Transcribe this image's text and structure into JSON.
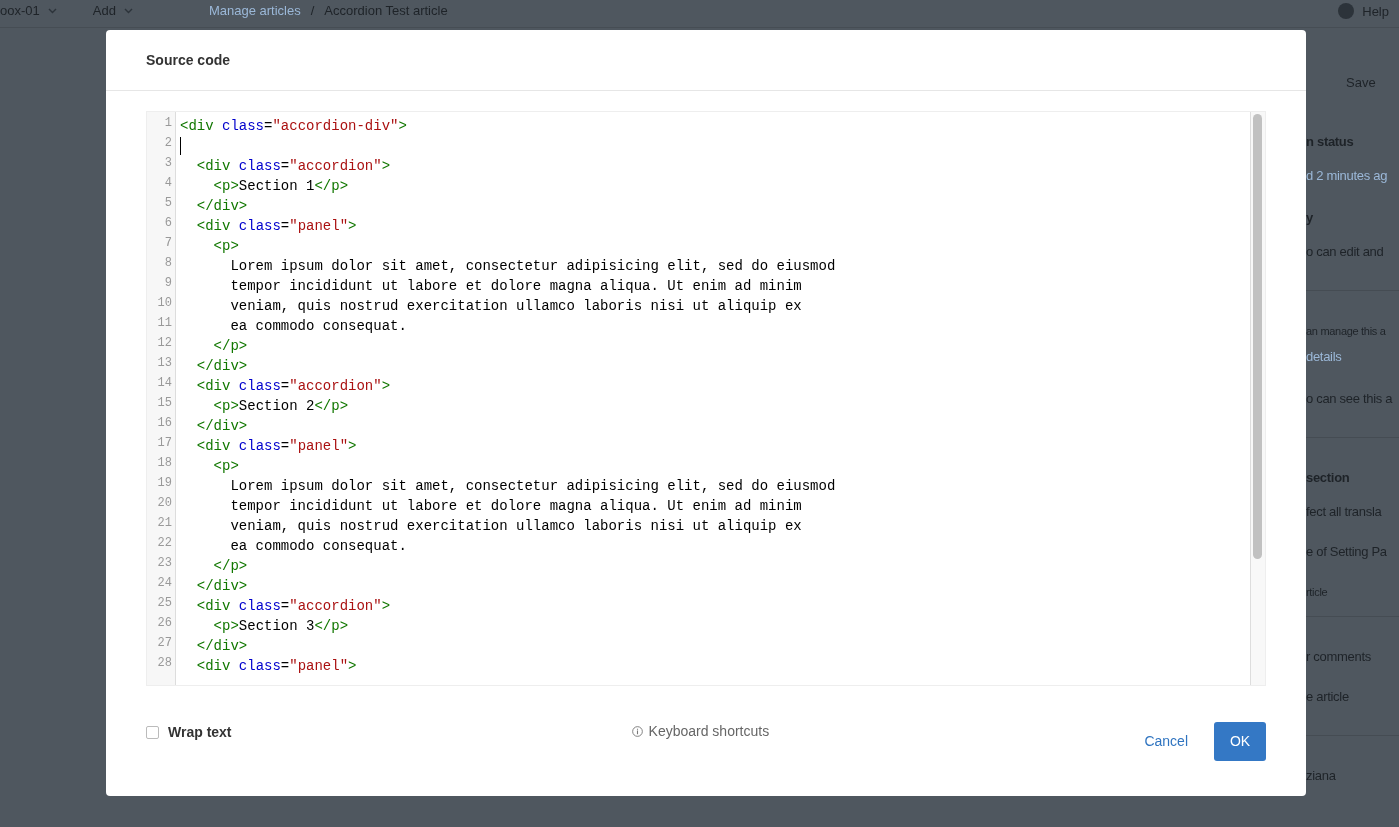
{
  "background_page": {
    "top_bar": {
      "items": [
        "oox-01",
        "Add"
      ],
      "breadcrumb": [
        "Manage articles",
        "/",
        "Accordion Test article"
      ],
      "help": "Help"
    },
    "side_panel": {
      "save_button": "Save",
      "fragments": [
        {
          "kind": "heading",
          "text": "n status"
        },
        {
          "kind": "link",
          "text": "d 2 minutes ag"
        },
        {
          "kind": "heading",
          "text": "y"
        },
        {
          "kind": "text",
          "text": "o can edit and"
        },
        {
          "kind": "rule"
        },
        {
          "kind": "small",
          "text": "an manage this a"
        },
        {
          "kind": "link",
          "text": "details"
        },
        {
          "kind": "text",
          "text": "o can see this a"
        },
        {
          "kind": "rule"
        },
        {
          "kind": "heading",
          "text": "section"
        },
        {
          "kind": "text",
          "text": "fect all transla"
        },
        {
          "kind": "text",
          "text": "e of Setting Pa"
        },
        {
          "kind": "small",
          "text": "rticle"
        },
        {
          "kind": "rule"
        },
        {
          "kind": "text",
          "text": "r comments"
        },
        {
          "kind": "text",
          "text": "e article"
        },
        {
          "kind": "rule"
        },
        {
          "kind": "text",
          "text": "ziana"
        }
      ]
    }
  },
  "dialog": {
    "title": "Source code",
    "editor": {
      "lines": [
        {
          "number": "1",
          "code": "<div class=\"accordion-div\">",
          "cursor": false
        },
        {
          "number": "2",
          "cursor": true
        },
        {
          "number": "3",
          "code": "  <div class=\"accordion\">",
          "cursor": false
        },
        {
          "number": "4",
          "code": "    <p>Section 1</p>",
          "cursor": false
        },
        {
          "number": "5",
          "code": "  </div>",
          "cursor": false
        },
        {
          "number": "6",
          "code": "  <div class=\"panel\">",
          "cursor": false
        },
        {
          "number": "7",
          "code": "    <p>",
          "cursor": false
        },
        {
          "number": "8",
          "code": "      Lorem ipsum dolor sit amet, consectetur adipisicing elit, sed do eiusmod",
          "cursor": false
        },
        {
          "number": "9",
          "code": "      tempor incididunt ut labore et dolore magna aliqua. Ut enim ad minim",
          "cursor": false
        },
        {
          "number": "10",
          "code": "      veniam, quis nostrud exercitation ullamco laboris nisi ut aliquip ex",
          "cursor": false
        },
        {
          "number": "11",
          "code": "      ea commodo consequat.",
          "cursor": false
        },
        {
          "number": "12",
          "code": "    </p>",
          "cursor": false
        },
        {
          "number": "13",
          "code": "  </div>",
          "cursor": false
        },
        {
          "number": "14",
          "code": "  <div class=\"accordion\">",
          "cursor": false
        },
        {
          "number": "15",
          "code": "    <p>Section 2</p>",
          "cursor": false
        },
        {
          "number": "16",
          "code": "  </div>",
          "cursor": false
        },
        {
          "number": "17",
          "code": "  <div class=\"panel\">",
          "cursor": false
        },
        {
          "number": "18",
          "code": "    <p>",
          "cursor": false
        },
        {
          "number": "19",
          "code": "      Lorem ipsum dolor sit amet, consectetur adipisicing elit, sed do eiusmod",
          "cursor": false
        },
        {
          "number": "20",
          "code": "      tempor incididunt ut labore et dolore magna aliqua. Ut enim ad minim",
          "cursor": false
        },
        {
          "number": "21",
          "code": "      veniam, quis nostrud exercitation ullamco laboris nisi ut aliquip ex",
          "cursor": false
        },
        {
          "number": "22",
          "code": "      ea commodo consequat.",
          "cursor": false
        },
        {
          "number": "23",
          "code": "    </p>",
          "cursor": false
        },
        {
          "number": "24",
          "code": "  </div>",
          "cursor": false
        },
        {
          "number": "25",
          "code": "  <div class=\"accordion\">",
          "cursor": false
        },
        {
          "number": "26",
          "code": "    <p>Section 3</p>",
          "cursor": false
        },
        {
          "number": "27",
          "code": "  </div>",
          "cursor": false
        },
        {
          "number": "28",
          "code": "  <div class=\"panel\">",
          "cursor": false
        }
      ]
    },
    "wrap_text": {
      "label": "Wrap text",
      "checked": false
    },
    "shortcuts_link": "Keyboard shortcuts",
    "buttons": {
      "cancel": "Cancel",
      "ok": "OK"
    }
  }
}
